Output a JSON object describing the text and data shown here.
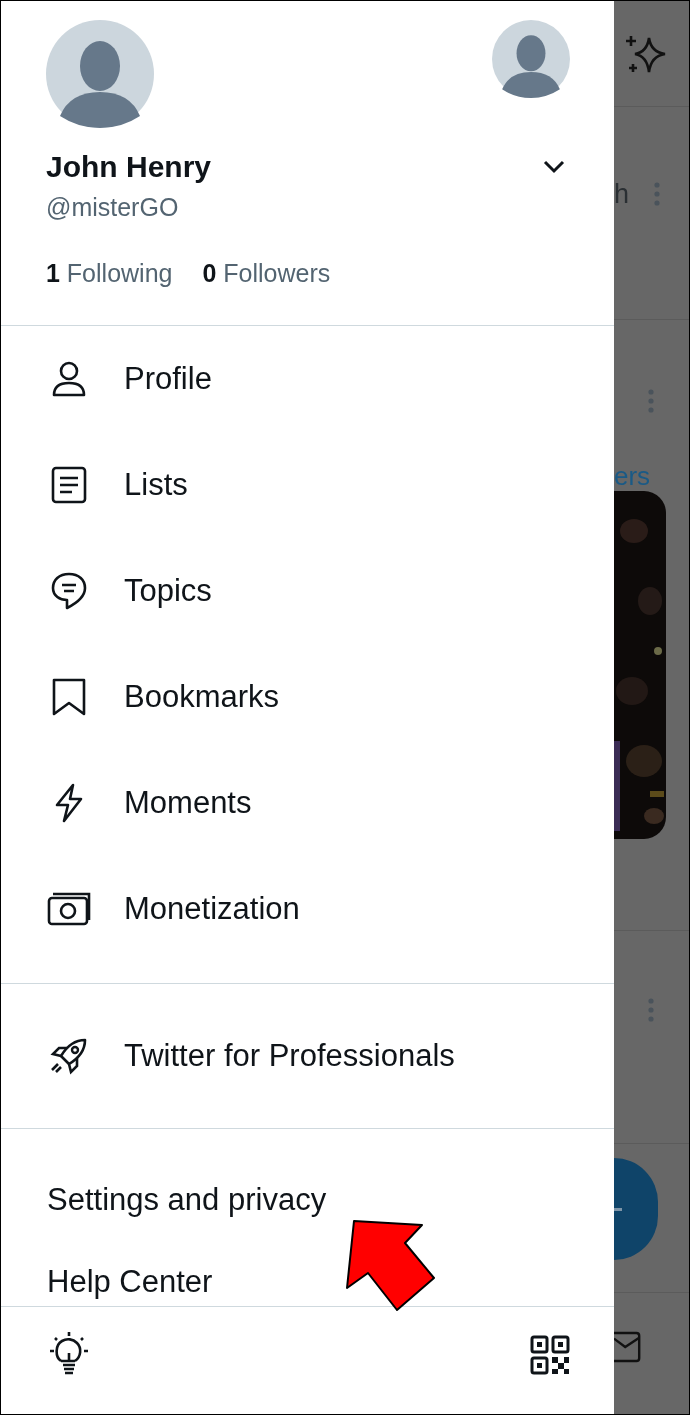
{
  "drawer": {
    "profile": {
      "name": "John Henry",
      "handle": "@misterGO",
      "following_count": "1",
      "following_label": "Following",
      "followers_count": "0",
      "followers_label": "Followers"
    },
    "menu": [
      {
        "label": "Profile",
        "kind": "person"
      },
      {
        "label": "Lists",
        "kind": "list"
      },
      {
        "label": "Topics",
        "kind": "topic"
      },
      {
        "label": "Bookmarks",
        "kind": "bookmark"
      },
      {
        "label": "Moments",
        "kind": "bolt"
      },
      {
        "label": "Monetization",
        "kind": "money"
      }
    ],
    "professional": {
      "label": "Twitter for Professionals"
    },
    "settings": [
      {
        "label": "Settings and privacy"
      },
      {
        "label": "Help Center"
      }
    ]
  },
  "feed": {
    "first_text": "h",
    "second_text": "ers"
  }
}
